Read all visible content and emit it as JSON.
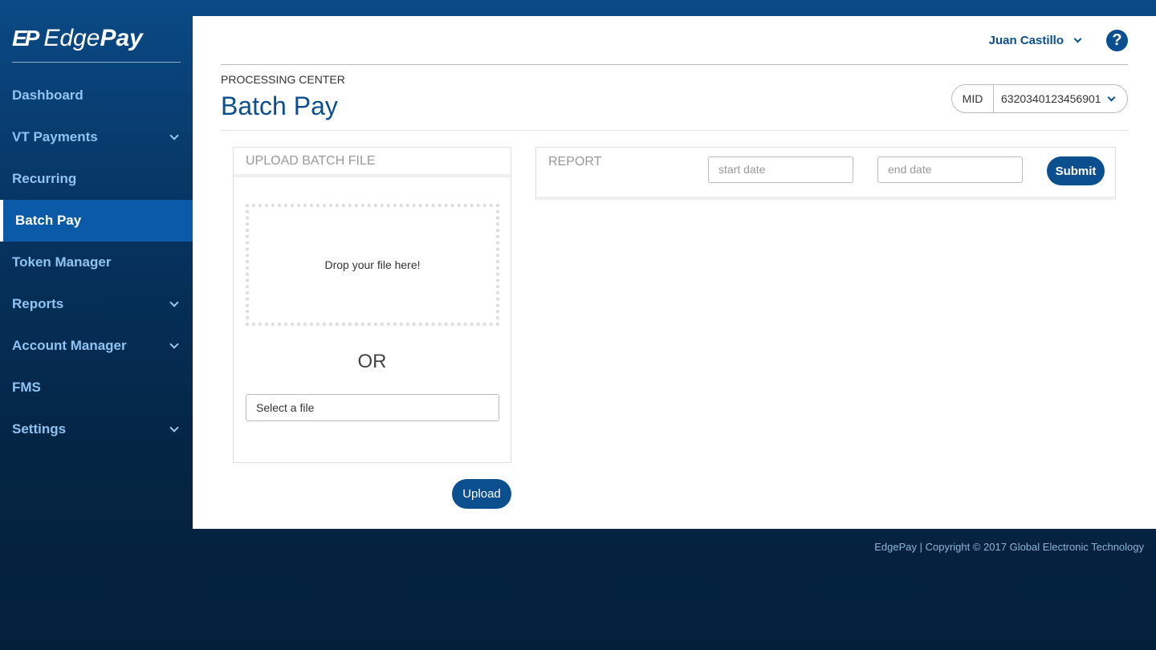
{
  "brand": {
    "mark": "EP",
    "name_light": "Edge",
    "name_bold": "Pay"
  },
  "sidebar": {
    "items": [
      {
        "label": "Dashboard",
        "has_submenu": false
      },
      {
        "label": "VT Payments",
        "has_submenu": true
      },
      {
        "label": "Recurring",
        "has_submenu": false
      },
      {
        "label": "Batch Pay",
        "has_submenu": false,
        "active": true
      },
      {
        "label": "Token Manager",
        "has_submenu": false
      },
      {
        "label": "Reports",
        "has_submenu": true
      },
      {
        "label": "Account Manager",
        "has_submenu": true
      },
      {
        "label": "FMS",
        "has_submenu": false
      },
      {
        "label": "Settings",
        "has_submenu": true
      }
    ]
  },
  "header": {
    "user_name": "Juan Castillo",
    "help_icon": "?"
  },
  "page": {
    "breadcrumb": "PROCESSING CENTER",
    "title": "Batch Pay",
    "mid_label": "MID",
    "mid_value": "6320340123456901"
  },
  "upload": {
    "heading": "UPLOAD BATCH FILE",
    "dropzone_text": "Drop your file here!",
    "or_text": "OR",
    "file_placeholder": "Select a file",
    "button": "Upload"
  },
  "report": {
    "heading": "REPORT",
    "start_placeholder": "start date",
    "end_placeholder": "end date",
    "button": "Submit"
  },
  "footer": {
    "text": "EdgePay | Copyright © 2017 Global Electronic Technology"
  },
  "colors": {
    "primary": "#0b4f8f",
    "active_nav": "#0b5aa8",
    "nav_text": "#8fc3f2"
  }
}
